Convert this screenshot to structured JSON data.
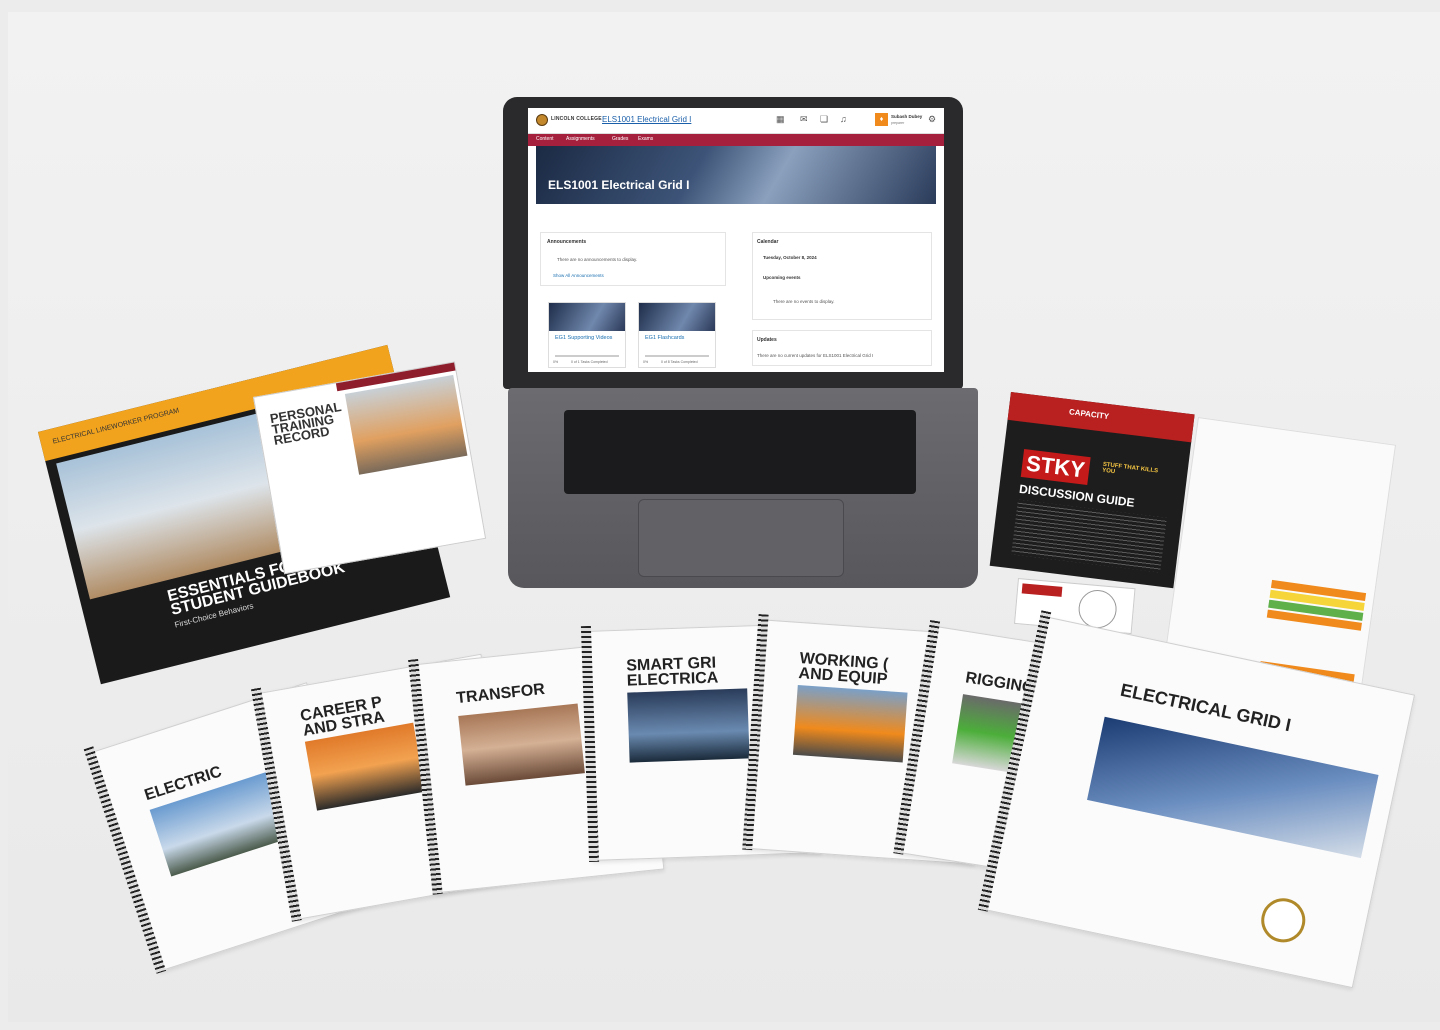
{
  "lms": {
    "logo_text": "LINCOLN COLLEGE",
    "course_title": "ELS1001 Electrical Grid I",
    "user_initial": "♦",
    "user_name": "Subash Dubey",
    "user_role": "preparer",
    "nav": [
      "Content",
      "Assignments",
      "Grades",
      "Exams"
    ],
    "banner_title": "ELS1001 Electrical Grid I",
    "announcements": {
      "title": "Announcements",
      "empty_text": "There are no announcements to display.",
      "link": "Show All Announcements"
    },
    "calendar": {
      "title": "Calendar",
      "date": "Tuesday, October 8, 2024",
      "upcoming_label": "Upcoming events",
      "empty_text": "There are no events to display."
    },
    "updates": {
      "title": "Updates",
      "text": "There are no current updates for ELS1001 Electrical Grid I"
    },
    "tiles": [
      {
        "title": "EG1 Supporting Videos",
        "pct": "0%",
        "progress": "0 of 1 Tasks Completed"
      },
      {
        "title": "EG1 Flashcards",
        "pct": "0%",
        "progress": "0 of 8 Tasks Completed"
      }
    ]
  },
  "guidebook": {
    "band": "ELECTRICAL LINEWORKER PROGRAM",
    "title": "ESSENTIALS FOR SUCCESS STUDENT GUIDEBOOK",
    "subtitle": "First-Choice Behaviors"
  },
  "ptr": {
    "title": "PERSONAL TRAINING RECORD"
  },
  "discussion_guide": {
    "brand": "CAPACITY",
    "stky": "STKY",
    "stky_sub": "STUFF THAT KILLS YOU",
    "title": "DISCUSSION GUIDE"
  },
  "spiral_books": [
    {
      "title": "ELECTRIC"
    },
    {
      "title": "CAREER P\nAND STRA"
    },
    {
      "title": "TRANSFOR"
    },
    {
      "title": "SMART GRI\nELECTRICA"
    },
    {
      "title": "WORKING (\nAND EQUIP"
    },
    {
      "title": "RIGGING"
    }
  ],
  "main_book": {
    "title": "ELECTRICAL GRID I"
  },
  "colors": {
    "nav": "#a5203d",
    "accent_orange": "#f08a1c",
    "link": "#1a5fa9",
    "guidebook_band": "#f2a31d",
    "stky_red": "#c51a1a"
  }
}
